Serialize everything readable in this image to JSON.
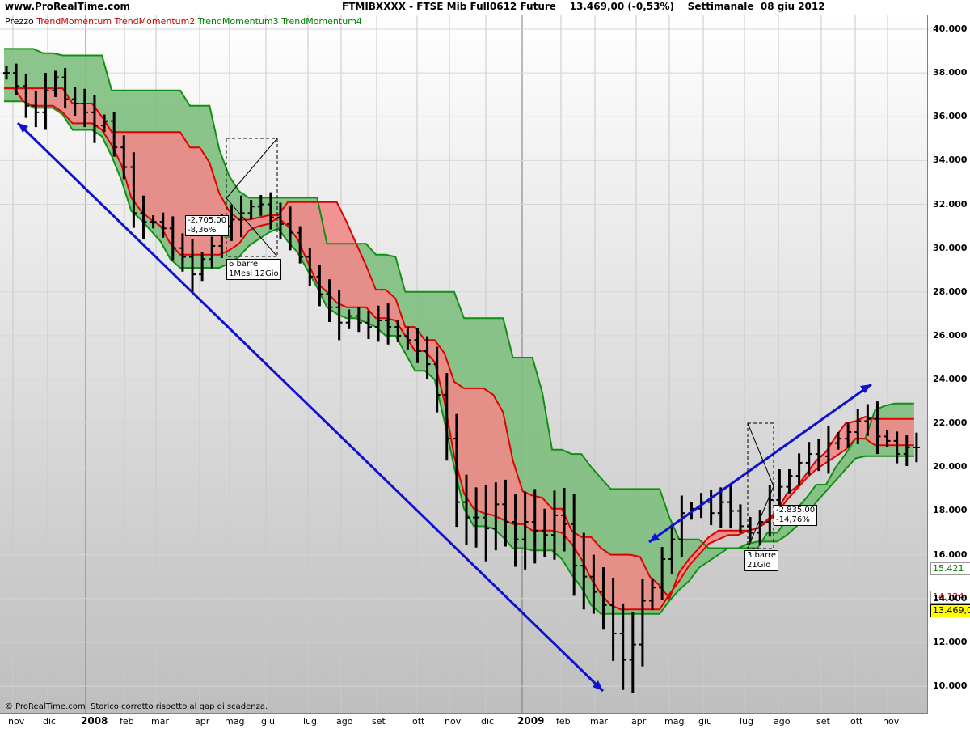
{
  "window": {
    "site": "www.ProRealTime.com",
    "title": "FTMIBXXXX - FTSE Mib Full0612 Future    13.469,00 (-0,53%)    Settimanale  08 giu 2012"
  },
  "legend": [
    {
      "label": "Prezzo",
      "color": "#000000"
    },
    {
      "label": "TrendMomentum",
      "color": "#cc0000"
    },
    {
      "label": "TrendMomentum2",
      "color": "#cc0000"
    },
    {
      "label": "TrendMomentum3",
      "color": "#008000"
    },
    {
      "label": "TrendMomentum4",
      "color": "#008000"
    }
  ],
  "copyright": "© ProRealTime.com  Storico corretto rispetto al gap di scadenza.",
  "price_tags": {
    "green": "15.421",
    "red": "14.124",
    "last": "13.469,0"
  },
  "annotations": {
    "a1_change": "-2.705,00",
    "a1_pct": "-8,36%",
    "a1_bars": "6 barre",
    "a1_span": "1Mesi 12Gio",
    "a2_change": "-2.835,00",
    "a2_pct": "-14,76%",
    "a2_bars": "3 barre",
    "a2_span": "21Gio"
  },
  "colors": {
    "red_band": "#f08a8a",
    "green_band": "#7fbf7f",
    "red_line": "#e00000",
    "green_line": "#109010",
    "trendline": "#1010d0"
  },
  "chart_data": {
    "type": "ohlc",
    "title": "FTMIBXXXX - FTSE Mib Full0612 Future",
    "timeframe": "Settimanale",
    "y_ticks": [
      "40.000",
      "38.000",
      "36.000",
      "34.000",
      "32.000",
      "30.000",
      "28.000",
      "26.000",
      "24.000",
      "22.000",
      "20.000",
      "18.000",
      "16.000",
      "14.000",
      "12.000",
      "10.000"
    ],
    "x_labels": [
      {
        "label": "nov"
      },
      {
        "label": "dic"
      },
      {
        "label": "2008",
        "bold": true
      },
      {
        "label": "feb"
      },
      {
        "label": "mar"
      },
      {
        "label": "apr"
      },
      {
        "label": "mag"
      },
      {
        "label": "giu"
      },
      {
        "label": "lug"
      },
      {
        "label": "ago"
      },
      {
        "label": "set"
      },
      {
        "label": "ott"
      },
      {
        "label": "nov"
      },
      {
        "label": "dic"
      },
      {
        "label": "2009",
        "bold": true
      },
      {
        "label": "feb"
      },
      {
        "label": "mar"
      },
      {
        "label": "apr"
      },
      {
        "label": "mag"
      },
      {
        "label": "giu"
      },
      {
        "label": "lug"
      },
      {
        "label": "ago"
      },
      {
        "label": "set"
      },
      {
        "label": "ott"
      },
      {
        "label": "nov"
      }
    ],
    "ylim": [
      9000,
      40500
    ],
    "close_approx": [
      38000,
      37400,
      36500,
      36200,
      37200,
      37800,
      36800,
      36600,
      36200,
      35600,
      35800,
      34600,
      33700,
      31600,
      31200,
      31200,
      30900,
      30000,
      29600,
      28800,
      29500,
      30100,
      31000,
      31300,
      31600,
      31900,
      32000,
      31400,
      31100,
      30700,
      29600,
      28700,
      27900,
      27300,
      26600,
      26900,
      26600,
      26400,
      26700,
      26400,
      26000,
      25800,
      25300,
      24700,
      23300,
      21300,
      18400,
      17700,
      17700,
      17200,
      18300,
      17500,
      16700,
      17500,
      17100,
      16900,
      17800,
      17400,
      15500,
      15000,
      14300,
      13700,
      12400,
      11200,
      11900,
      13900,
      14500,
      15800,
      16700,
      17900,
      18100,
      18400,
      17900,
      18400,
      18000,
      17300,
      17000,
      17500,
      18500,
      19100,
      19600,
      20200,
      20600,
      20500,
      21100,
      21300,
      21600,
      22100,
      22200,
      21400,
      21200,
      20600,
      20900,
      20900
    ]
  }
}
